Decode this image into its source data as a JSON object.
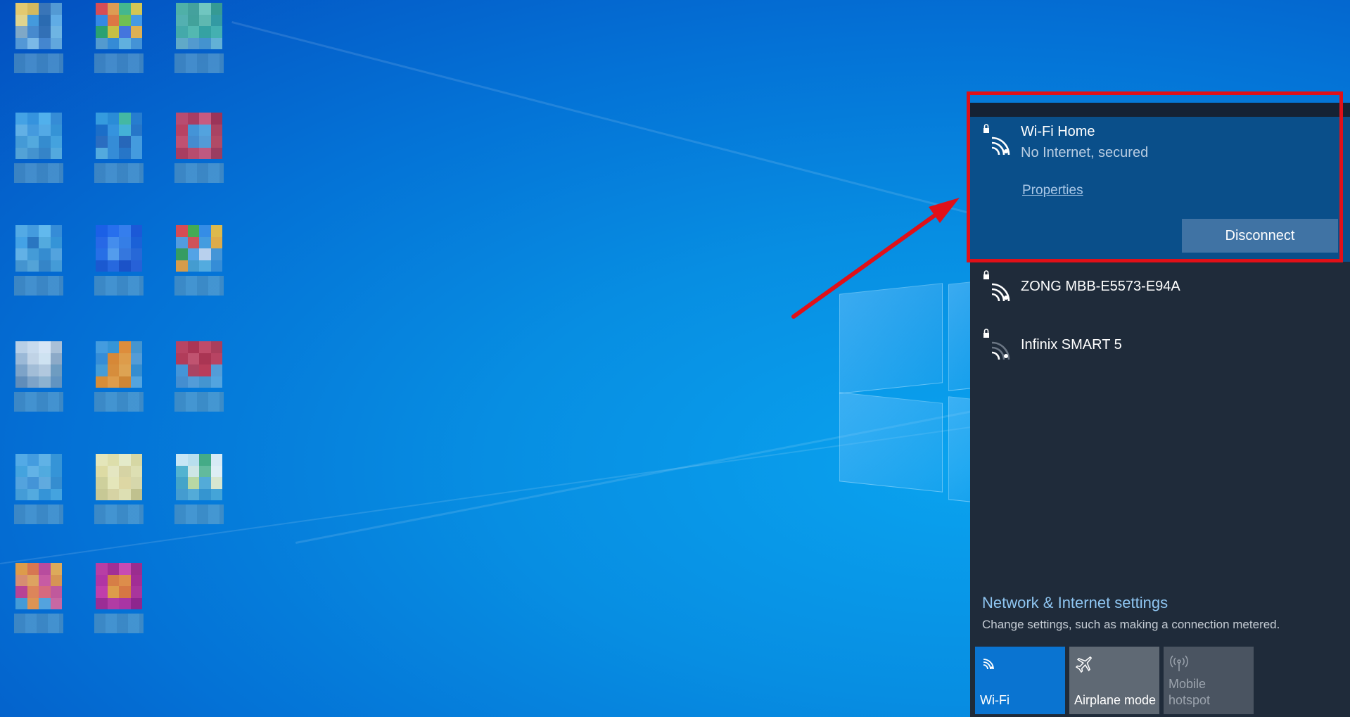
{
  "desktop": {
    "wallpaper": "windows-10-hero-blue",
    "icons": [
      {
        "colors": [
          "#f7d46a",
          "#e6c257",
          "#3e78b8",
          "#5aa0d6",
          "#f3e08a",
          "#4aa0e0",
          "#2f6db0",
          "#68b4e8",
          "#8ab0c8",
          "#4d8fcf",
          "#3673b5",
          "#78bde6",
          "#5a9ed8",
          "#86c2ea",
          "#4a8ad0",
          "#6aaee0"
        ]
      },
      {
        "colors": [
          "#e84d4d",
          "#f0a24a",
          "#4ac08a",
          "#e6d04a",
          "#3a8ee8",
          "#f07a3a",
          "#7ac84a",
          "#4aa0e8",
          "#2ea86a",
          "#d8c83a",
          "#4a78e0",
          "#f0b84a",
          "#5aa0d0",
          "#3a90d8",
          "#68b8e0",
          "#4a98d8"
        ]
      },
      {
        "colors": [
          "#56b8a6",
          "#4aa89a",
          "#7ad0c0",
          "#3aa090",
          "#5ab8b0",
          "#48a898",
          "#66c0b0",
          "#38a0a0",
          "#4ab0a8",
          "#5ac0b0",
          "#3aa8a0",
          "#4ab8b0",
          "#68b0c8",
          "#5aa0d0",
          "#4a98d0",
          "#6ab8d8"
        ]
      },
      {
        "colors": [
          "#4aa8e8",
          "#3a98e0",
          "#58b8f0",
          "#3a90d8",
          "#6ab8e8",
          "#4aa0e0",
          "#5ab0e8",
          "#3a98d8",
          "#4aa0d8",
          "#5ab0e0",
          "#3a90d0",
          "#4aa8e0",
          "#5aa8d8",
          "#4a98d0",
          "#3a88c8",
          "#5ab0e0"
        ]
      },
      {
        "colors": [
          "#3aa0e0",
          "#2e90d8",
          "#4ac0a0",
          "#2a80d0",
          "#1e70c8",
          "#3a98e0",
          "#4ab8d8",
          "#2a78c8",
          "#2e6ec0",
          "#3a90d8",
          "#2a68b8",
          "#4aa0e0",
          "#5ab0e0",
          "#3a90d8",
          "#2a78c8",
          "#4aa0e0"
        ]
      },
      {
        "colors": [
          "#c84a6a",
          "#b83a5a",
          "#d85a7a",
          "#a83050",
          "#c8405a",
          "#4a98d8",
          "#5aa8e0",
          "#b8405a",
          "#d0506a",
          "#4a90d0",
          "#5aa0d8",
          "#c0485e",
          "#b83a58",
          "#c84a66",
          "#d0587a",
          "#a83a58"
        ]
      },
      {
        "colors": [
          "#5ab0e8",
          "#4aa0e0",
          "#6ac0f0",
          "#3a90d8",
          "#4aa8e8",
          "#2e78c0",
          "#5ab0e0",
          "#3a98d8",
          "#6ab8e8",
          "#4aa0d8",
          "#3a90d0",
          "#5aa8e0",
          "#4a98d0",
          "#5aa8d8",
          "#3a88c8",
          "#4aa0d8"
        ]
      },
      {
        "colors": [
          "#1e60e8",
          "#2a70f0",
          "#3a80f0",
          "#1e58d8",
          "#2a68e8",
          "#4a90f0",
          "#3a80e8",
          "#1e60d8",
          "#2a70e8",
          "#5aa0f0",
          "#3a78e0",
          "#2a68d8",
          "#1e58d0",
          "#2a68e0",
          "#1e50c8",
          "#2a60d8"
        ]
      },
      {
        "colors": [
          "#e84a4a",
          "#4ab04a",
          "#3a90e8",
          "#f0c040",
          "#5aa0e0",
          "#e05050",
          "#4aa0e0",
          "#f0b040",
          "#3aa05a",
          "#5aa8e8",
          "#c8d8f0",
          "#4a98d8",
          "#e8a040",
          "#4aa0d0",
          "#5ab0e0",
          "#3a90d8"
        ]
      },
      {
        "colors": [
          "#c8d8e8",
          "#d8e4f0",
          "#e8f0f8",
          "#b8c8d8",
          "#a8c0d8",
          "#d0dce8",
          "#e0ecf4",
          "#98b0c8",
          "#88a8c8",
          "#b0c4d8",
          "#c0d0e0",
          "#78a0c0",
          "#6890b8",
          "#88a8c8",
          "#98b8d0",
          "#6a98c0"
        ]
      },
      {
        "colors": [
          "#4aa0e0",
          "#3a98d8",
          "#f09030",
          "#4a98d0",
          "#3a90d8",
          "#e88a2a",
          "#f0a040",
          "#5aa0d8",
          "#4aa0d8",
          "#e89030",
          "#f0a848",
          "#3a90d0",
          "#e8902a",
          "#f0a040",
          "#e08828",
          "#5aa8e0"
        ]
      },
      {
        "colors": [
          "#c8405a",
          "#b8304a",
          "#d04860",
          "#b83a52",
          "#c03850",
          "#d05068",
          "#b83048",
          "#c8405a",
          "#4a98d8",
          "#b8405a",
          "#c83850",
          "#5aa0d8",
          "#4a90d0",
          "#5aa0d8",
          "#4a98d0",
          "#5aa8e0"
        ]
      },
      {
        "colors": [
          "#5ab0e8",
          "#4aa0e0",
          "#68b8e8",
          "#3a98d8",
          "#4aa8e0",
          "#6ab8e8",
          "#58b0e0",
          "#3a98d8",
          "#5aa8e0",
          "#4a98d8",
          "#68b0e0",
          "#3a90d0",
          "#4aa0d8",
          "#5ab0e0",
          "#3a98d8",
          "#4aa8e0"
        ]
      },
      {
        "colors": [
          "#f8f0b8",
          "#f0e8a8",
          "#f8f4c8",
          "#e8e0a0",
          "#f0e4a0",
          "#f8f0c0",
          "#e8dca0",
          "#f0e8b0",
          "#e0d898",
          "#f8f0b8",
          "#f0e0a0",
          "#e8e0a8",
          "#d8d090",
          "#e8dca0",
          "#f0e8b0",
          "#d0c888"
        ]
      },
      {
        "colors": [
          "#d8f0f8",
          "#c8e8f0",
          "#4ab080",
          "#e8f4f8",
          "#5ab8d0",
          "#e0f0e8",
          "#6ac098",
          "#f0f8f8",
          "#4aa8c8",
          "#c8e0a0",
          "#5ab0d8",
          "#e8f0d0",
          "#4aa0d0",
          "#5ab0d8",
          "#3a98d0",
          "#4aa8d8"
        ]
      },
      {
        "colors": [
          "#f0a040",
          "#e87848",
          "#c84a9a",
          "#f0b050",
          "#e8906a",
          "#f0a858",
          "#d85aa0",
          "#e8984a",
          "#c84090",
          "#f08850",
          "#e86a78",
          "#d05898",
          "#4aa0d8",
          "#f0984a",
          "#5aa8e0",
          "#d868a0"
        ]
      },
      {
        "colors": [
          "#c83aa0",
          "#b02a90",
          "#d848b0",
          "#a82888",
          "#c030a0",
          "#e8803a",
          "#f09040",
          "#b02890",
          "#d03aa8",
          "#f0a040",
          "#e87838",
          "#b83098",
          "#a82890",
          "#c038a0",
          "#b830a0",
          "#9a2088"
        ]
      }
    ]
  },
  "flyout": {
    "networks": [
      {
        "name": "Wi-Fi Home",
        "status": "No Internet, secured",
        "properties_label": "Properties",
        "button_label": "Disconnect",
        "icon": "wifi-secured-icon",
        "signal": "full"
      },
      {
        "name": "ZONG MBB-E5573-E94A",
        "icon": "wifi-secured-icon",
        "signal": "full"
      },
      {
        "name": "Infinix SMART 5",
        "icon": "wifi-secured-icon",
        "signal": "weak"
      }
    ],
    "settings": {
      "title": "Network & Internet settings",
      "description": "Change settings, such as making a connection metered."
    },
    "quick_actions": [
      {
        "label": "Wi-Fi",
        "icon": "wifi-icon",
        "state": "on"
      },
      {
        "label": "Airplane mode",
        "icon": "airplane-icon",
        "state": "off"
      },
      {
        "label_line1": "Mobile",
        "label_line2": "hotspot",
        "icon": "hotspot-icon",
        "state": "disabled"
      }
    ]
  },
  "colors": {
    "flyout_bg": "#1f2b3a",
    "connected_bg": "#0a4f8a",
    "accent": "#0a74d1",
    "annotation_red": "#e01018"
  }
}
